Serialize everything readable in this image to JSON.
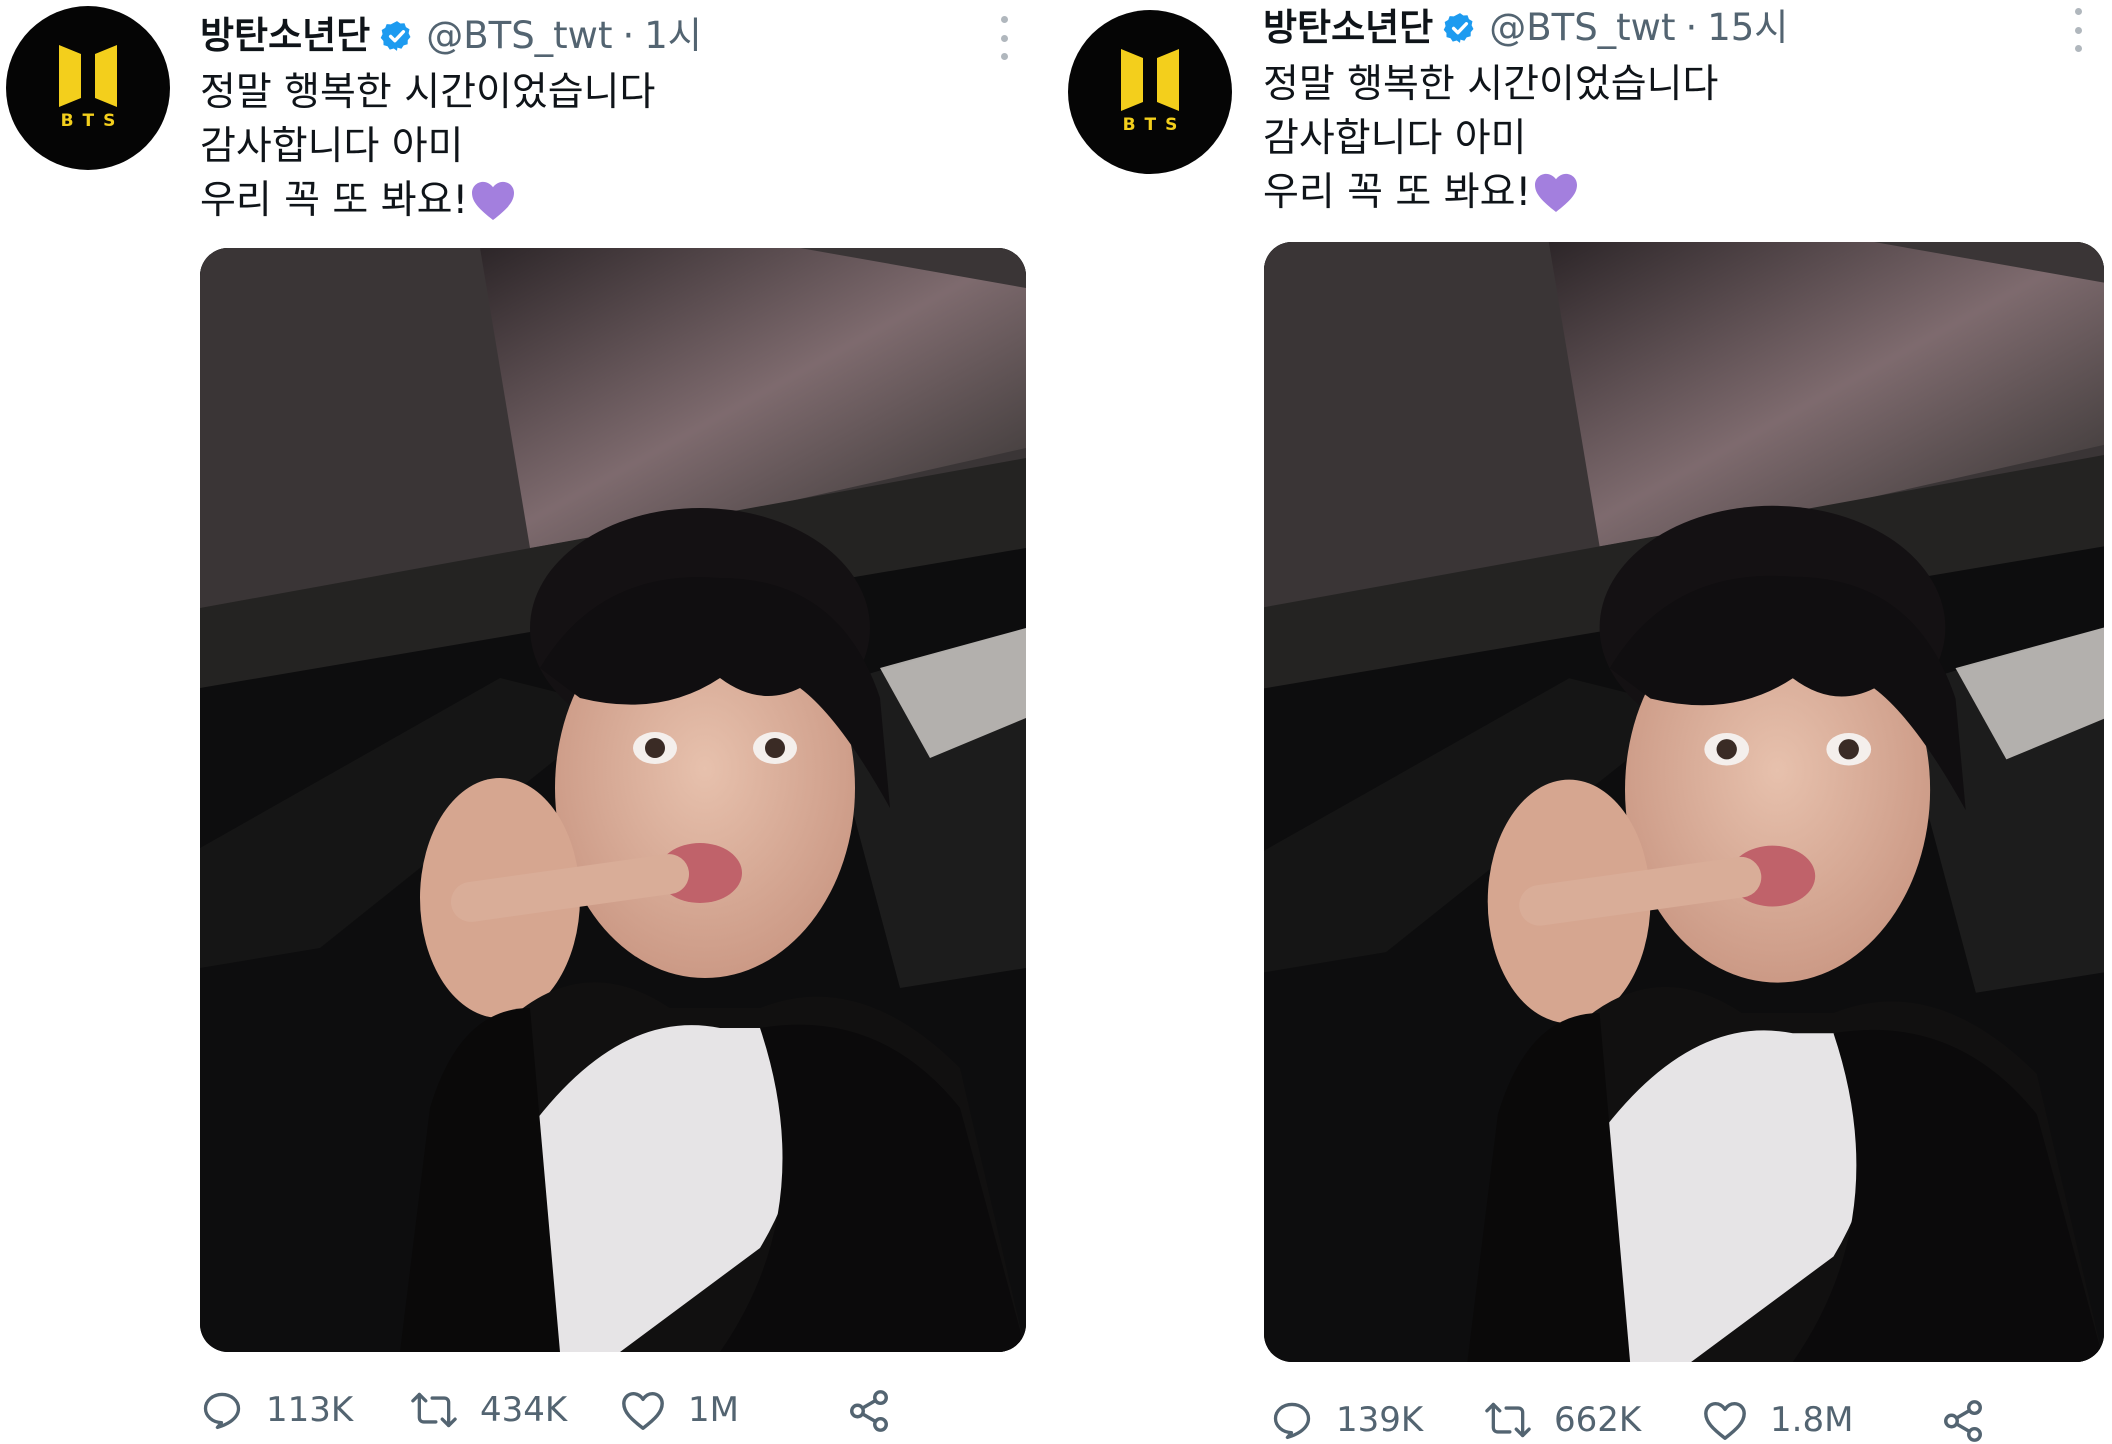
{
  "tweets": [
    {
      "name": "방탄소년단",
      "handle": "@BTS_twt",
      "separator": "·",
      "time": "1시",
      "avatar_logo_text": "BTS",
      "lines": [
        "정말 행복한 시간이었습니다",
        "감사합니다 아미",
        "우리 꼭 또 봐요!"
      ],
      "emoji": "purple-heart",
      "replies": "113K",
      "retweets": "434K",
      "likes": "1M"
    },
    {
      "name": "방탄소년단",
      "handle": "@BTS_twt",
      "separator": "·",
      "time": "15시",
      "avatar_logo_text": "BTS",
      "lines": [
        "정말 행복한 시간이었습니다",
        "감사합니다 아미",
        "우리 꼭 또 봐요!"
      ],
      "emoji": "purple-heart",
      "replies": "139K",
      "retweets": "662K",
      "likes": "1.8M"
    }
  ],
  "icons": {
    "verified": "verified-badge-icon",
    "more": "more-options-icon",
    "reply": "reply-icon",
    "retweet": "retweet-icon",
    "like": "like-icon",
    "share": "share-icon"
  },
  "colors": {
    "verified": "#1d9bf0",
    "secondary_text": "#536471",
    "logo_yellow": "#f3cf1c",
    "emoji_purple": "#a37fde"
  }
}
